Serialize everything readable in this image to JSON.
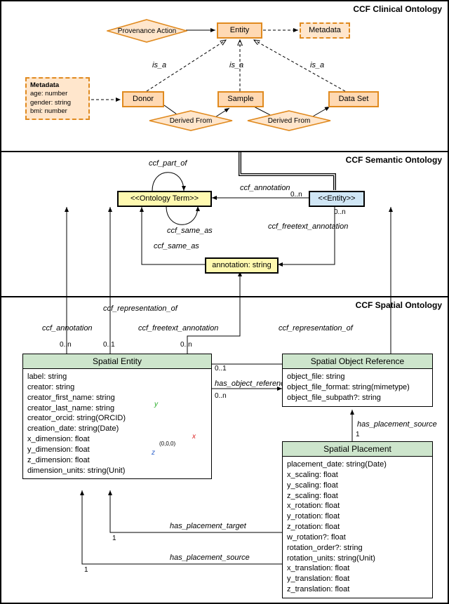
{
  "panels": {
    "clinical": {
      "title": "CCF Clinical Ontology"
    },
    "semantic": {
      "title": "CCF Semantic Ontology"
    },
    "spatial": {
      "title": "CCF Spatial Ontology"
    }
  },
  "clinical": {
    "provenance_action": "Provenance Action",
    "entity": "Entity",
    "metadata_top": "Metadata",
    "donor": "Donor",
    "sample": "Sample",
    "dataset": "Data Set",
    "derived_from_1": "Derived From",
    "derived_from_2": "Derived From",
    "metadata_box": {
      "title": "Metadata",
      "line1": "age: number",
      "line2": "gender: string",
      "line3": "bmi: number"
    },
    "is_a_1": "is_a",
    "is_a_2": "is_a",
    "is_a_3": "is_a"
  },
  "semantic": {
    "ontology_term": "<<Ontology Term>>",
    "entity": "<<Entity>>",
    "annotation": "annotation: string",
    "ccf_part_of": "ccf_part_of",
    "ccf_same_as_loop": "ccf_same_as",
    "ccf_same_as_edge": "ccf_same_as",
    "ccf_annotation": "ccf_annotation",
    "ccf_freetext_annotation": "ccf_freetext_annotation",
    "card_0n_1": "0..n",
    "card_0n_2": "0..n"
  },
  "spatial": {
    "rel_rep_of_1": "ccf_representation_of",
    "rel_rep_of_2": "ccf_representation_of",
    "rel_annotation": "ccf_annotation",
    "rel_freetext": "ccf_freetext_annotation",
    "card_0n_a": "0..n",
    "card_01_a": "0..1",
    "card_0n_b": "0..n",
    "card_01_b": "0..1",
    "card_0n_c": "0..n",
    "card_1_a": "1",
    "card_1_b": "1",
    "card_1_c": "1",
    "has_obj_ref": "has_object_reference",
    "has_place_src1": "has_placement_source",
    "has_place_tgt": "has_placement_target",
    "has_place_src2": "has_placement_source",
    "axis_origin": "(0,0,0)",
    "axis_x": "x",
    "axis_y": "y",
    "axis_z": "z",
    "spatial_entity": {
      "title": "Spatial Entity",
      "a0": "label: string",
      "a1": "creator: string",
      "a2": "creator_first_name: string",
      "a3": "creator_last_name: string",
      "a4": "creator_orcid: string(ORCID)",
      "a5": "creation_date: string(Date)",
      "a6": "x_dimension: float",
      "a7": "y_dimension: float",
      "a8": "z_dimension: float",
      "a9": "dimension_units: string(Unit)"
    },
    "spatial_obj_ref": {
      "title": "Spatial Object Reference",
      "a0": "object_file: string",
      "a1": "object_file_format: string(mimetype)",
      "a2": "object_file_subpath?: string"
    },
    "spatial_placement": {
      "title": "Spatial Placement",
      "a0": "placement_date: string(Date)",
      "a1": "x_scaling: float",
      "a2": "y_scaling: float",
      "a3": "z_scaling: float",
      "a4": "x_rotation: float",
      "a5": "y_rotation: float",
      "a6": "z_rotation: float",
      "a7": "w_rotation?: float",
      "a8": "rotation_order?: string",
      "a9": "rotation_units: string(Unit)",
      "a10": "x_translation: float",
      "a11": "y_translation: float",
      "a12": "z_translation: float"
    }
  }
}
